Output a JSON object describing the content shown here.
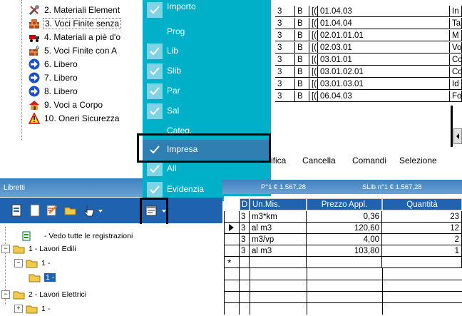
{
  "tree_top": {
    "items": [
      {
        "label": "2. Materiali Element",
        "icon": "tools-icon"
      },
      {
        "label": "3. Voci Finite senza",
        "icon": "bricks-icon"
      },
      {
        "label": "4. Materiali a piè d'o",
        "icon": "truck-icon"
      },
      {
        "label": "5. Voci Finite con A",
        "icon": "bricks-a-icon"
      },
      {
        "label": "6. Libero",
        "icon": "blue-arrow-icon"
      },
      {
        "label": "7. Libero",
        "icon": "blue-arrow-icon"
      },
      {
        "label": "8. Libero",
        "icon": "blue-arrow-icon"
      },
      {
        "label": "9. Voci a Corpo",
        "icon": "house-icon"
      },
      {
        "label": "10. Oneri Sicurezza",
        "icon": "warning-icon"
      }
    ]
  },
  "grid_top": {
    "rows": [
      {
        "c1": "3",
        "c2": "B",
        "c3": "[(",
        "c4": "01.04.03",
        "c5": "In"
      },
      {
        "c1": "3",
        "c2": "B",
        "c3": "[(",
        "c4": "01.04.04",
        "c5": "Ta"
      },
      {
        "c1": "3",
        "c2": "B",
        "c3": "[(",
        "c4": "02.01.01.01",
        "c5": "M"
      },
      {
        "c1": "3",
        "c2": "B",
        "c3": "[(",
        "c4": "02.03.01",
        "c5": "Vo"
      },
      {
        "c1": "3",
        "c2": "B",
        "c3": "[(",
        "c4": "03.01.01",
        "c5": "Co"
      },
      {
        "c1": "3",
        "c2": "B",
        "c3": "[(",
        "c4": "03.01.02.01",
        "c5": "Co"
      },
      {
        "c1": "3",
        "c2": "B",
        "c3": "[(",
        "c4": "03.01.03.01",
        "c5": "Id"
      },
      {
        "c1": "3",
        "c2": "B",
        "c3": "[(",
        "c4": "06.04.03",
        "c5": "Fo"
      }
    ]
  },
  "menu": {
    "items": [
      {
        "label": "Importo",
        "checked": true
      },
      {
        "label": "Prog",
        "checked": false
      },
      {
        "label": "Lib",
        "checked": true
      },
      {
        "label": "Slib",
        "checked": true
      },
      {
        "label": "Par",
        "checked": true
      },
      {
        "label": "Sal",
        "checked": true
      },
      {
        "label": "Categ.",
        "checked": false
      },
      {
        "label": "Impresa",
        "checked": true
      },
      {
        "label": "All",
        "checked": true
      },
      {
        "label": "Evidenzia",
        "checked": true
      }
    ],
    "selected_color": "#2f7fb2",
    "bg_color": "#00b0c8"
  },
  "menubar": {
    "items": [
      "ifica",
      "Cancella",
      "Comandi",
      "Selezione"
    ]
  },
  "libretti": {
    "title": "Libretti",
    "status_left": "P°1 € 1.567,28",
    "status_right": "SLib n°1 € 1.567,28"
  },
  "tree_bottom": {
    "items": [
      {
        "label": "- Vedo tutte le registrazioni",
        "icon": "register-icon"
      },
      {
        "label": "1 - Lavori Edili",
        "icon": "folder-open-icon"
      },
      {
        "label": "1 -",
        "icon": "folder-open-icon"
      },
      {
        "label": "1 -",
        "icon": "folder-icon"
      },
      {
        "label": "2 - Lavori Elettrici",
        "icon": "folder-open-icon"
      },
      {
        "label": "1 -",
        "icon": "folder-icon"
      }
    ]
  },
  "grid_bottom": {
    "headers": [
      "D",
      "Un.Mis.",
      "Prezzo Appl.",
      "Quantità"
    ],
    "rows": [
      {
        "d": "3",
        "um": "m3*km",
        "prezzo": "0,36",
        "qta": "23"
      },
      {
        "d": "3",
        "um": "al m3",
        "prezzo": "120,60",
        "qta": "12"
      },
      {
        "d": "3",
        "um": "m3/vp",
        "prezzo": "4,00",
        "qta": "2"
      },
      {
        "d": "3",
        "um": "al m3",
        "prezzo": "103,80",
        "qta": "1"
      }
    ]
  }
}
